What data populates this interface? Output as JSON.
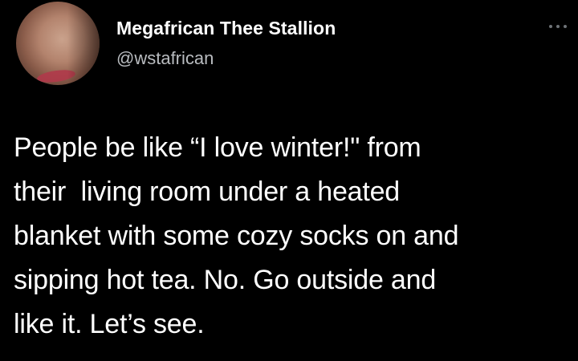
{
  "tweet": {
    "author": {
      "display_name": "Megafrican Thee Stallion",
      "handle": "@wstafrican",
      "avatar_icon": "profile-photo"
    },
    "more_icon": "more-horizontal-icon",
    "text_lines": [
      "People be like “I love winter!\" from",
      "their  living room under a heated",
      "blanket with some cozy socks on and",
      "sipping hot tea. No. Go outside and",
      "like it. Let’s see."
    ]
  },
  "colors": {
    "background": "#000000",
    "name": "#ffffff",
    "handle": "#b9bcc0",
    "body_text": "#ffffff",
    "more_dots": "#6e7377"
  }
}
